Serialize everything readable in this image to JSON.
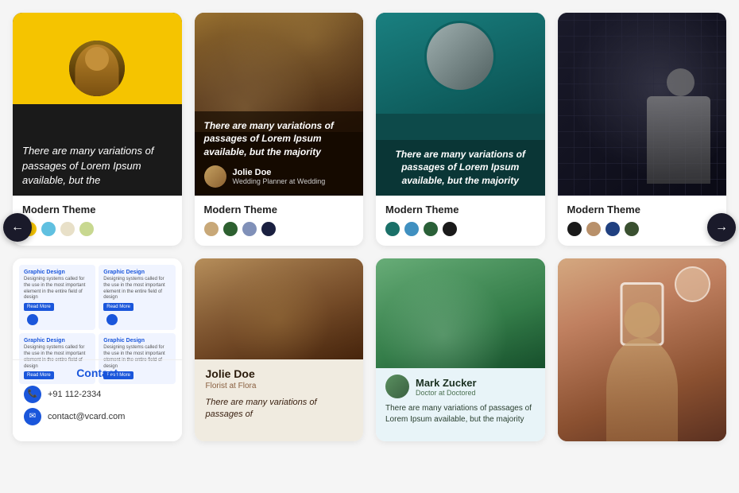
{
  "cards": {
    "top": [
      {
        "id": "card1",
        "theme": "Modern Theme",
        "quote": "There are many variations of passages of Lorem Ipsum available, but the",
        "colors": [
          "#f5c400",
          "#60c0e0",
          "#e8e0c8",
          "#c8d890"
        ]
      },
      {
        "id": "card2",
        "theme": "Modern Theme",
        "quote": "There are many variations of passages of Lorem Ipsum available, but the majority",
        "author_name": "Jolie Doe",
        "author_role": "Wedding Planner at Wedding",
        "colors": [
          "#c8a878",
          "#2d6030",
          "#8090b8",
          "#1a2040"
        ]
      },
      {
        "id": "card3",
        "theme": "Modern Theme",
        "quote": "There are many variations of passages of Lorem Ipsum available, but the majority",
        "colors": [
          "#1a7068",
          "#4090c0",
          "#2a6038",
          "#1a1a1a"
        ]
      },
      {
        "id": "card4",
        "theme": "Modern Theme",
        "colors": [
          "#1a1a1a",
          "#b8906a",
          "#204080",
          "#3a5030"
        ]
      }
    ],
    "bottom": [
      {
        "id": "card5",
        "contact_title": "Contact",
        "phone": "+91 112-2334",
        "email": "contact@vcard.com",
        "mini_title": "Graphic Design",
        "mini_text": "Designing systems called for the use in the most important element in the entire field of design",
        "read_more": "Read More"
      },
      {
        "id": "card6",
        "name": "Jolie Doe",
        "role": "Florist at Flora",
        "quote": "There are many variations of passages of"
      },
      {
        "id": "card7",
        "name": "Mark Zucker",
        "role": "Doctor at Doctored",
        "text": "There are many variations of passages of Lorem Ipsum available, but the majority"
      },
      {
        "id": "card8"
      }
    ]
  },
  "nav": {
    "left_arrow": "←",
    "right_arrow": "→"
  }
}
